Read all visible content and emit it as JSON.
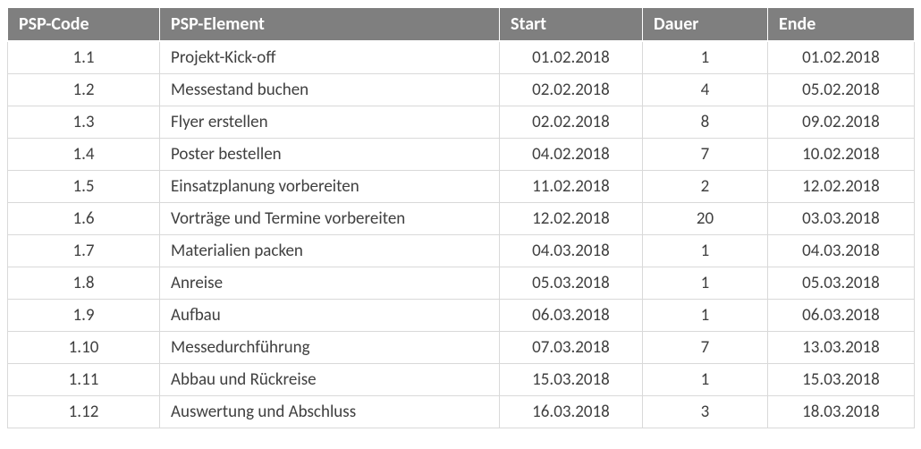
{
  "table": {
    "headers": {
      "code": "PSP-Code",
      "element": "PSP-Element",
      "start": "Start",
      "dauer": "Dauer",
      "ende": "Ende"
    },
    "rows": [
      {
        "code": "1.1",
        "element": "Projekt-Kick-off",
        "start": "01.02.2018",
        "dauer": "1",
        "ende": "01.02.2018"
      },
      {
        "code": "1.2",
        "element": "Messestand buchen",
        "start": "02.02.2018",
        "dauer": "4",
        "ende": "05.02.2018"
      },
      {
        "code": "1.3",
        "element": "Flyer erstellen",
        "start": "02.02.2018",
        "dauer": "8",
        "ende": "09.02.2018"
      },
      {
        "code": "1.4",
        "element": "Poster bestellen",
        "start": "04.02.2018",
        "dauer": "7",
        "ende": "10.02.2018"
      },
      {
        "code": "1.5",
        "element": "Einsatzplanung vorbereiten",
        "start": "11.02.2018",
        "dauer": "2",
        "ende": "12.02.2018"
      },
      {
        "code": "1.6",
        "element": "Vorträge und Termine vorbereiten",
        "start": "12.02.2018",
        "dauer": "20",
        "ende": "03.03.2018"
      },
      {
        "code": "1.7",
        "element": "Materialien packen",
        "start": "04.03.2018",
        "dauer": "1",
        "ende": "04.03.2018"
      },
      {
        "code": "1.8",
        "element": "Anreise",
        "start": "05.03.2018",
        "dauer": "1",
        "ende": "05.03.2018"
      },
      {
        "code": "1.9",
        "element": "Aufbau",
        "start": "06.03.2018",
        "dauer": "1",
        "ende": "06.03.2018"
      },
      {
        "code": "1.10",
        "element": "Messedurchführung",
        "start": "07.03.2018",
        "dauer": "7",
        "ende": "13.03.2018"
      },
      {
        "code": "1.11",
        "element": "Abbau und Rückreise",
        "start": "15.03.2018",
        "dauer": "1",
        "ende": "15.03.2018"
      },
      {
        "code": "1.12",
        "element": "Auswertung und Abschluss",
        "start": "16.03.2018",
        "dauer": "3",
        "ende": "18.03.2018"
      }
    ]
  }
}
